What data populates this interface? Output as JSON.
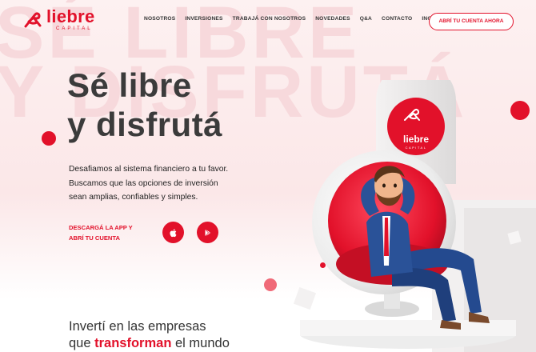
{
  "brand": {
    "name": "liebre",
    "tagline": "CAPITAL",
    "color_primary": "#e2112a",
    "color_text_dark": "#3b3b3b"
  },
  "header": {
    "nav": [
      {
        "label": "NOSOTROS"
      },
      {
        "label": "INVERSIONES"
      },
      {
        "label": "TRABAJÁ CON NOSOTROS"
      },
      {
        "label": "NOVEDADES"
      },
      {
        "label": "Q&A"
      },
      {
        "label": "CONTACTO"
      },
      {
        "label": "INGRESÁ"
      }
    ],
    "cta_label": "ABRÍ TU CUENTA AHORA"
  },
  "background_watermark": {
    "line1": "SÉ LIBRE",
    "line2": "Y DISFRUTÁ"
  },
  "hero": {
    "title_line1": "Sé libre",
    "title_line2": "y disfrutá",
    "description_line1": "Desafiamos al sistema financiero a tu favor.",
    "description_line2": "Buscamos que las opciones de inversión",
    "description_line3": "sean amplias, confiables y simples.",
    "download_line1": "DESCARGÁ LA APP Y",
    "download_line2": "ABRÍ TU CUENTA",
    "app_store_icon": "apple-icon",
    "play_store_icon": "google-play-icon"
  },
  "illustration": {
    "sign_brand": "liebre",
    "sign_tagline": "CAPITAL"
  },
  "section": {
    "heading_line1": "Invertí en las empresas",
    "heading_prefix": "que ",
    "heading_accent": "transforman",
    "heading_suffix": " el mundo"
  }
}
